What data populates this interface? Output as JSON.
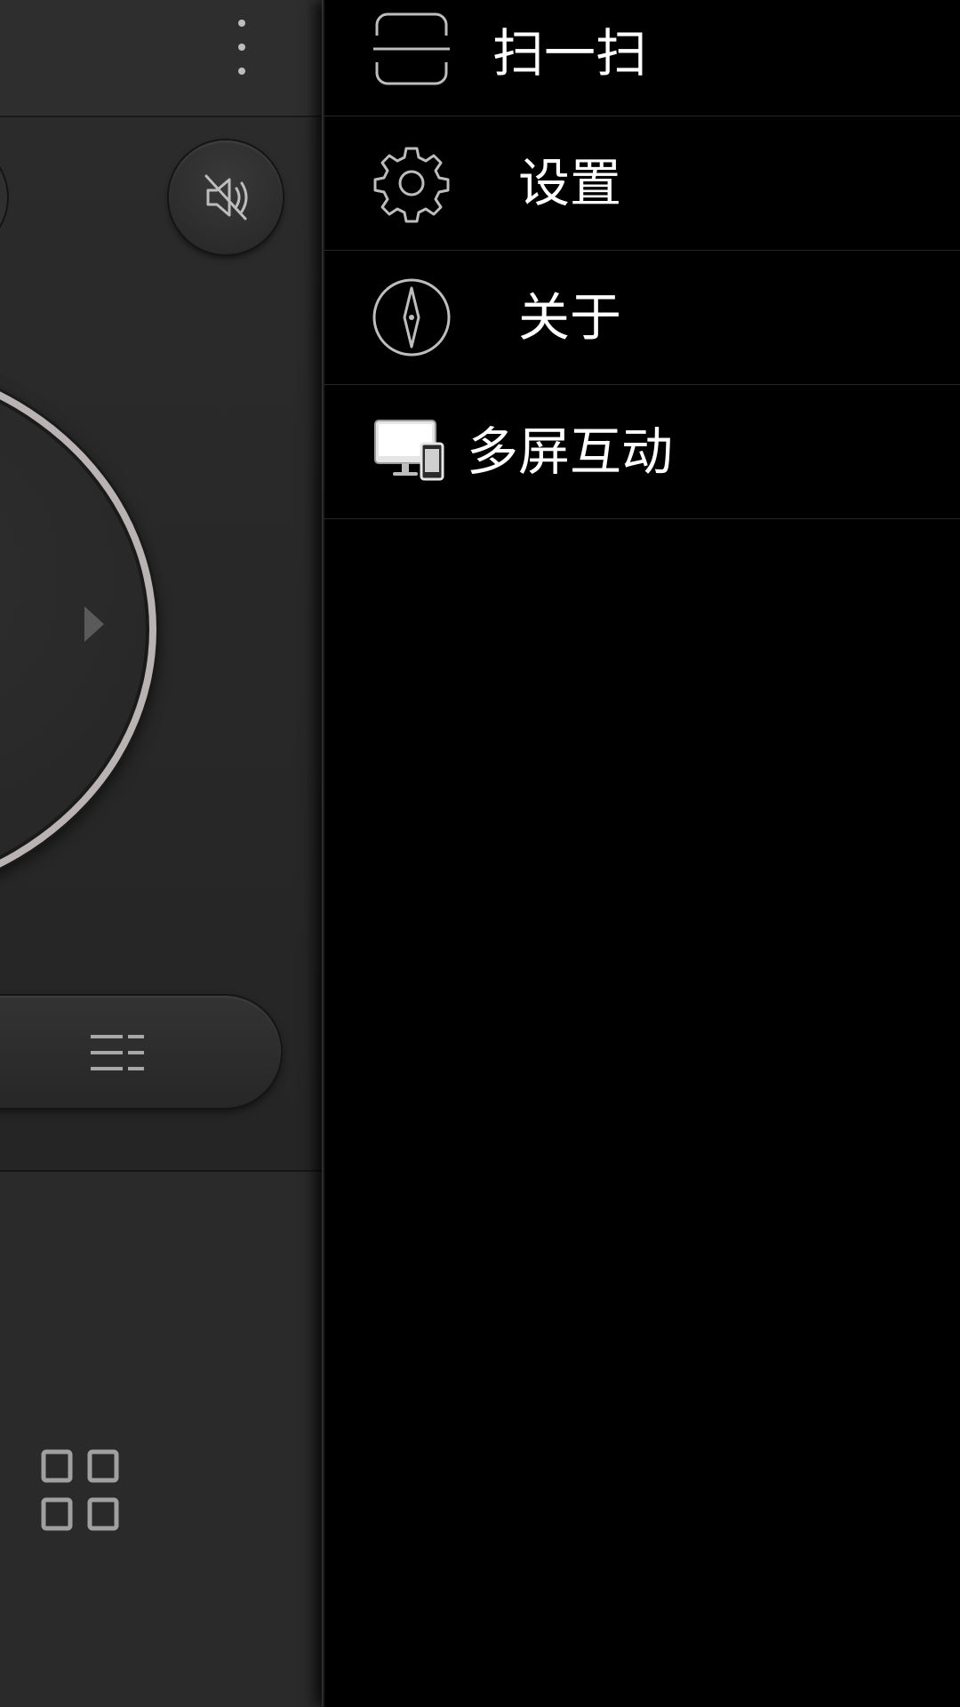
{
  "drawer": {
    "items": [
      {
        "label": "扫一扫",
        "icon": "scan-icon"
      },
      {
        "label": "设置",
        "icon": "gear-icon"
      },
      {
        "label": "关于",
        "icon": "compass-icon"
      },
      {
        "label": "多屏互动",
        "icon": "multi-screen-icon"
      }
    ]
  },
  "remote": {
    "icons": [
      "overflow-menu-icon",
      "mute-icon",
      "right-arrow-icon",
      "menu-icon",
      "apps-grid-icon"
    ]
  },
  "colors": {
    "drawer_bg": "#000000",
    "remote_bg": "#2a2a2a",
    "ring": "#b9b3b4",
    "text": "#ffffff"
  }
}
